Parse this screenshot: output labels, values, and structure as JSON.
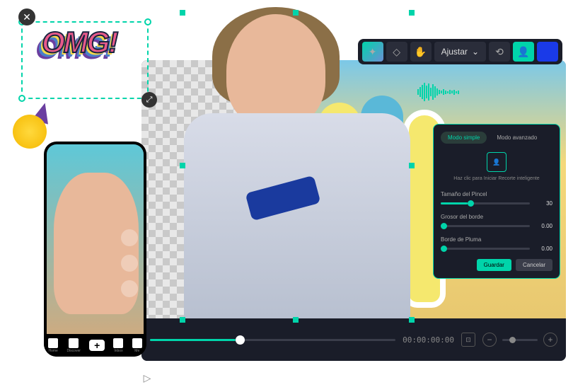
{
  "sticker": {
    "text": "OMG!"
  },
  "toolbar": {
    "magic_icon": "✦",
    "eraser_icon": "◇",
    "hand_icon": "✋",
    "adjust_label": "Ajustar",
    "chevron": "⌄",
    "refresh_icon": "⟲",
    "profile_icon": "👤"
  },
  "panel": {
    "tab_simple": "Modo simple",
    "tab_advanced": "Modo avanzado",
    "hint": "Haz clic para Iniciar Recorte inteligente",
    "brush_label": "Tamaño del Pincel",
    "brush_value": "30",
    "edge_thickness_label": "Grosor del borde",
    "edge_thickness_value": "0.00",
    "feather_label": "Borde de Pluma",
    "feather_value": "0.00",
    "save_label": "Guardar",
    "cancel_label": "Cancelar"
  },
  "timeline": {
    "timecode": "00:00:00:00",
    "play_icon": "▷",
    "fit_icon": "⊡",
    "minus": "−",
    "plus": "+"
  },
  "phone_nav": {
    "home": "Home",
    "discover": "Discover",
    "inbox": "Inbox",
    "me": "Me"
  },
  "close_icon": "✕",
  "resize_icon": "⤢"
}
